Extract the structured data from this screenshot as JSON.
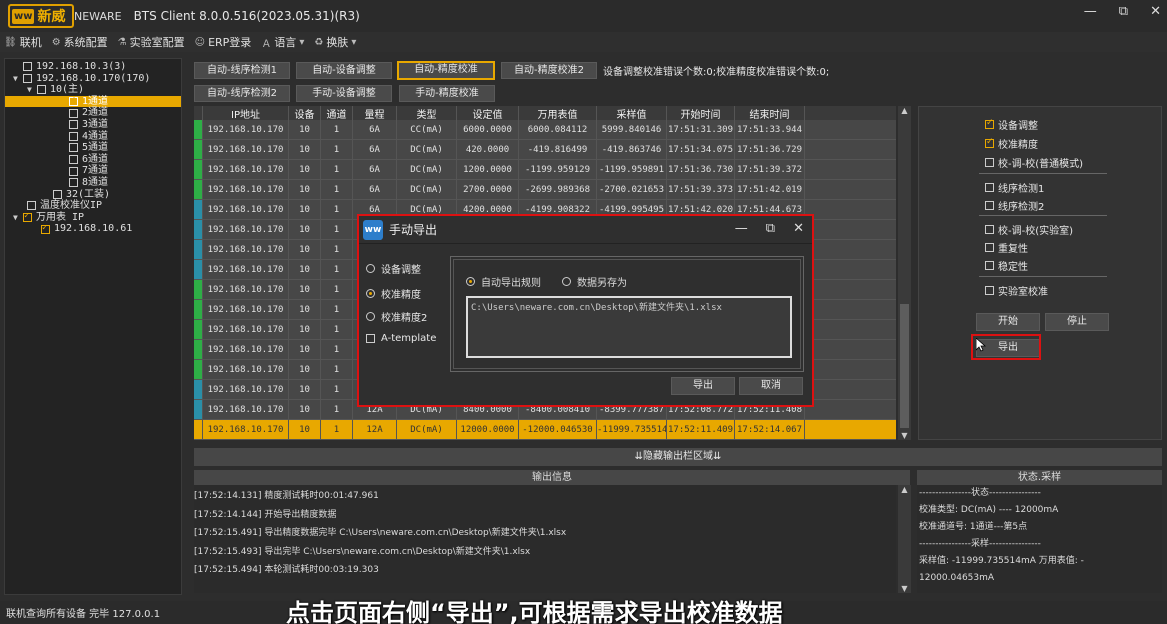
{
  "app": {
    "logo_main": "新威",
    "logo_sub": "NEWARE",
    "logo_badge": "ww",
    "title": "BTS Client 8.0.0.516(2023.05.31)(R3)",
    "win_min": "—",
    "win_restore": "⧉",
    "win_close": "✕"
  },
  "menu": [
    {
      "label": "联机"
    },
    {
      "label": "系统配置"
    },
    {
      "label": "实验室配置"
    },
    {
      "label": "ERP登录"
    },
    {
      "label": "语言"
    },
    {
      "label": "换肤"
    }
  ],
  "tree": [
    {
      "label": "192.168.10.3(3)",
      "checked": false
    },
    {
      "label": "192.168.10.170(170)",
      "checked": false
    },
    {
      "label": "10(主)",
      "checked": false
    },
    {
      "label": "1通道",
      "checked": true
    },
    {
      "label": "2通道",
      "checked": false
    },
    {
      "label": "3通道",
      "checked": false
    },
    {
      "label": "4通道",
      "checked": false
    },
    {
      "label": "5通道",
      "checked": false
    },
    {
      "label": "6通道",
      "checked": false
    },
    {
      "label": "7通道",
      "checked": false
    },
    {
      "label": "8通道",
      "checked": false
    },
    {
      "label": "32(工装)",
      "checked": false
    },
    {
      "label": "温度校准仪IP",
      "checked": false
    },
    {
      "label": "万用表 IP",
      "checked": true
    },
    {
      "label": "192.168.10.61",
      "checked": true
    }
  ],
  "toolbar": {
    "b1": "自动-线序检测1",
    "b2": "自动-设备调整",
    "b3": "自动-精度校准",
    "b4": "自动-精度校准2",
    "b5": "自动-线序检测2",
    "b6": "手动-设备调整",
    "b7": "手动-精度校准",
    "error_info": "设备调整校准错误个数:0;校准精度校准错误个数:0;"
  },
  "table": {
    "headers": [
      "IP地址",
      "设备",
      "通道",
      "量程",
      "类型",
      "设定值",
      "万用表值",
      "采样值",
      "开始时间",
      "结束时间"
    ],
    "rows": [
      {
        "c": [
          "192.168.10.170",
          "10",
          "1",
          "6A",
          "CC(mA)",
          "6000.0000",
          "6000.084112",
          "5999.840146",
          "17:51:31.309",
          "17:51:33.944"
        ]
      },
      {
        "c": [
          "192.168.10.170",
          "10",
          "1",
          "6A",
          "DC(mA)",
          "420.0000",
          "-419.816499",
          "-419.863746",
          "17:51:34.075",
          "17:51:36.729"
        ]
      },
      {
        "c": [
          "192.168.10.170",
          "10",
          "1",
          "6A",
          "DC(mA)",
          "1200.0000",
          "-1199.959129",
          "-1199.959891",
          "17:51:36.730",
          "17:51:39.372"
        ]
      },
      {
        "c": [
          "192.168.10.170",
          "10",
          "1",
          "6A",
          "DC(mA)",
          "2700.0000",
          "-2699.989368",
          "-2700.021653",
          "17:51:39.373",
          "17:51:42.019"
        ]
      },
      {
        "c": [
          "192.168.10.170",
          "10",
          "1",
          "6A",
          "DC(mA)",
          "4200.0000",
          "-4199.908322",
          "-4199.995495",
          "17:51:42.020",
          "17:51:44.673"
        ]
      },
      {
        "c": [
          "192.168.10.170",
          "10",
          "1",
          "",
          "",
          "",
          "",
          "",
          "",
          ""
        ]
      },
      {
        "c": [
          "192.168.10.170",
          "10",
          "1",
          "",
          "",
          "",
          "",
          "",
          "",
          ""
        ]
      },
      {
        "c": [
          "192.168.10.170",
          "10",
          "1",
          "",
          "",
          "",
          "",
          "",
          "",
          ""
        ]
      },
      {
        "c": [
          "192.168.10.170",
          "10",
          "1",
          "",
          "",
          "",
          "",
          "",
          "",
          ""
        ]
      },
      {
        "c": [
          "192.168.10.170",
          "10",
          "1",
          "",
          "",
          "",
          "",
          "",
          "",
          ""
        ]
      },
      {
        "c": [
          "192.168.10.170",
          "10",
          "1",
          "",
          "",
          "",
          "",
          "",
          "",
          ""
        ]
      },
      {
        "c": [
          "192.168.10.170",
          "10",
          "1",
          "",
          "",
          "",
          "",
          "",
          "",
          ""
        ]
      },
      {
        "c": [
          "192.168.10.170",
          "10",
          "1",
          "",
          "",
          "",
          "",
          "",
          "",
          ""
        ]
      },
      {
        "c": [
          "192.168.10.170",
          "10",
          "1",
          "",
          "",
          "",
          "",
          "",
          "",
          ""
        ]
      },
      {
        "c": [
          "192.168.10.170",
          "10",
          "1",
          "12A",
          "DC(mA)",
          "8400.0000",
          "-8400.008410",
          "-8399.777387",
          "17:52:08.772",
          "17:52:11.408"
        ]
      },
      {
        "c": [
          "192.168.10.170",
          "10",
          "1",
          "12A",
          "DC(mA)",
          "12000.0000",
          "-12000.046530",
          "-11999.735514",
          "17:52:11.409",
          "17:52:14.067"
        ]
      }
    ]
  },
  "right_panel": {
    "opt1": "设备调整",
    "opt2": "校准精度",
    "opt3": "校-调-校(普通模式)",
    "opt4": "线序检测1",
    "opt5": "线序检测2",
    "opt6": "校-调-校(实验室)",
    "opt7": "重复性",
    "opt8": "稳定性",
    "opt9": "实验室校准",
    "start": "开始",
    "stop": "停止",
    "export": "导出"
  },
  "hidebar": "⇊隐藏输出栏区域⇊",
  "log": {
    "header": "输出信息",
    "lines": [
      "[17:52:14.131] 精度测试耗时00:01:47.961",
      "[17:52:14.144] 开始导出精度数据",
      "[17:52:15.491] 导出精度数据完毕 C:\\Users\\neware.com.cn\\Desktop\\新建文件夹\\1.xlsx",
      "[17:52:15.493] 导出完毕 C:\\Users\\neware.com.cn\\Desktop\\新建文件夹\\1.xlsx",
      "[17:52:15.494] 本轮测试耗时00:03:19.303"
    ]
  },
  "status": {
    "header": "状态.采样",
    "lines": [
      "----------------状态----------------",
      "校准类型: DC(mA) ---- 12000mA",
      "校准通道号: 1通道---第5点",
      "----------------采样----------------",
      "采样值: -11999.735514mA 万用表值: -",
      "12000.04653mA"
    ]
  },
  "bottom": {
    "status_text": "联机查询所有设备 完毕 127.0.0.1",
    "caption": "点击页面右侧“导出”,可根据需求导出校准数据"
  },
  "dialog": {
    "icon": "ww",
    "title": "手动导出",
    "opt1": "设备调整",
    "opt2": "校准精度",
    "opt3": "校准精度2",
    "opt4": "A-template",
    "rule1": "自动导出规则",
    "rule2": "数据另存为",
    "path": "C:\\Users\\neware.com.cn\\Desktop\\新建文件夹\\1.xlsx",
    "export": "导出",
    "cancel": "取消",
    "min": "—",
    "restore": "⧉",
    "close": "✕"
  },
  "colors": {
    "accent": "#e8a800",
    "highlight_box": "#dd1111",
    "green_marker": "#2eae46",
    "teal_marker": "#2a8fa8"
  }
}
